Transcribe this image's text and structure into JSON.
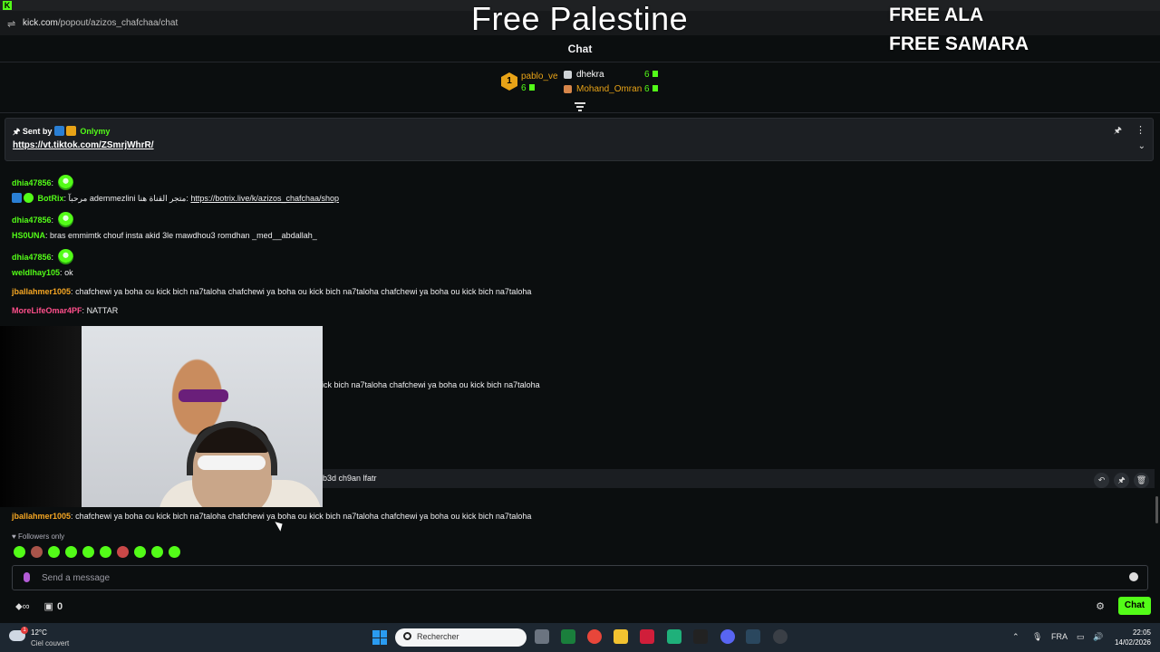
{
  "browser": {
    "host": "kick.com",
    "path": "/popout/azizos_chafchaa/chat"
  },
  "overlay": {
    "banner_center": "Free Palestine",
    "banner_right_1": "FREE ALA",
    "banner_right_2": "FREE SAMARA"
  },
  "chat": {
    "title": "Chat",
    "leaderboard": [
      {
        "rank": "1",
        "name": "pablo_ve",
        "count": "6",
        "color": "#e8a317"
      },
      {
        "name": "dhekra",
        "count": "6",
        "color": "#ffffff"
      },
      {
        "name": "Mohand_Omran",
        "count": "6",
        "color": "#e8a317"
      }
    ],
    "pinned": {
      "sent_by_label": "Sent by",
      "sender": "Onlymy",
      "link": "https://vt.tiktok.com/ZSmrjWhrR/"
    },
    "messages": [
      {
        "user": "dhia47856",
        "sep": ":",
        "text": "",
        "user_color": "#53fc18"
      },
      {
        "user": "BotRix",
        "sep": ":",
        "text": "مرحبآ ademmezlini متجر القناة هنا: ",
        "link": "https://botrix.live/k/azizos_chafchaa/shop",
        "user_color": "#53fc18"
      },
      {
        "user": "dhia47856",
        "sep": ":",
        "text": "",
        "user_color": "#53fc18"
      },
      {
        "user": "HS0UNA",
        "sep": ":",
        "text": "bras emmimtk chouf insta akid 3le mawdhou3 romdhan _med__abdallah_",
        "user_color": "#53fc18"
      },
      {
        "user": "dhia47856",
        "sep": ":",
        "text": "",
        "user_color": "#53fc18"
      },
      {
        "user": "weldlhay105",
        "sep": ":",
        "text": "ok",
        "user_color": "#53fc18"
      },
      {
        "user": "jballahmer1005",
        "sep": ":",
        "text": "chafchewi ya boha ou kick bich na7taloha chafchewi ya boha ou kick bich na7taloha chafchewi ya boha ou kick bich na7taloha",
        "user_color": "#f5a623"
      },
      {
        "user": "MoreLifeOmar4PF",
        "sep": ":",
        "text": "NATTAR",
        "user_color": "#ff4f8b"
      }
    ],
    "partial_message": "ick bich na7taloha chafchewi ya boha ou kick bich na7taloha",
    "highlighted_message": "b3d ch9an lfatr",
    "last_message": {
      "user": "jballahmer1005",
      "sep": ":",
      "text": "chafchewi ya boha ou kick bich na7taloha chafchewi ya boha ou kick bich na7taloha chafchewi ya boha ou kick bich na7taloha",
      "user_color": "#f5a623"
    },
    "followers_only": "Followers only",
    "input_placeholder": "Send a message",
    "points_count": "0",
    "chat_button": "Chat",
    "accent": "#53fc18"
  },
  "taskbar": {
    "temperature": "12°C",
    "weather": "Ciel couvert",
    "weather_alert": "1",
    "search_placeholder": "Rechercher",
    "lang": "FRA",
    "time": "22:05",
    "date": "14/02/2026"
  }
}
